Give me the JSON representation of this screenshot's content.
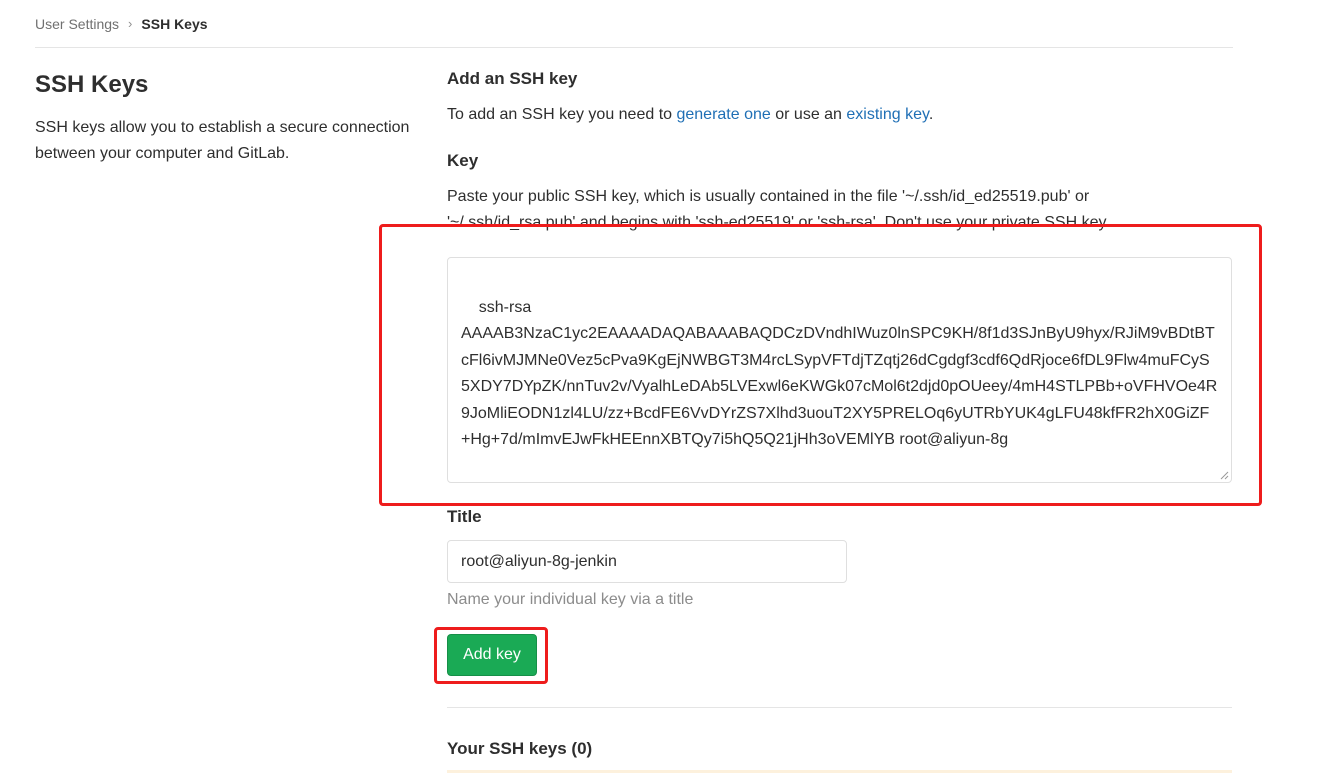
{
  "breadcrumb": {
    "parent": "User Settings",
    "separator": "›",
    "current": "SSH Keys"
  },
  "sidebar": {
    "heading": "SSH Keys",
    "description": "SSH keys allow you to establish a secure connection between your computer and GitLab."
  },
  "form": {
    "section_title": "Add an SSH key",
    "intro_prefix": "To add an SSH key you need to ",
    "generate_link": "generate one",
    "intro_middle": " or use an ",
    "existing_link": "existing key",
    "intro_suffix": ".",
    "key_label": "Key",
    "key_help": "Paste your public SSH key, which is usually contained in the file '~/.ssh/id_ed25519.pub' or '~/.ssh/id_rsa.pub' and begins with 'ssh-ed25519' or 'ssh-rsa'. Don't use your private SSH key.",
    "key_value": "ssh-rsa\nAAAAB3NzaC1yc2EAAAADAQABAAABAQDCzDVndhIWuz0lnSPC9KH/8f1d3SJnByU9hyx/RJiM9vBDtBTcFl6ivMJMNe0Vez5cPva9KgEjNWBGT3M4rcLSypVFTdjTZqtj26dCgdgf3cdf6QdRjoce6fDL9Flw4muFCyS5XDY7DYpZK/nnTuv2v/VyalhLeDAb5LVExwl6eKWGk07cMol6t2djd0pOUeey/4mH4STLPBb+oVFHVOe4R9JoMliEODN1zl4LU/zz+BcdFE6VvDYrZS7Xlhd3uouT2XY5PRELOq6yUTRbYUK4gLFU48kfFR2hX0GiZF+Hg+7d/mImvEJwFkHEEnnXBTQy7i5hQ5Q21jHh3oVEMlYB root@aliyun-8g",
    "title_label": "Title",
    "title_value": "root@aliyun-8g-jenkin",
    "title_hint": "Name your individual key via a title",
    "submit_label": "Add key"
  },
  "keys_list": {
    "heading": "Your SSH keys (0)"
  },
  "colors": {
    "primary_button": "#1aaa55",
    "link": "#1f6fb5",
    "highlight": "#ee1c1c"
  }
}
